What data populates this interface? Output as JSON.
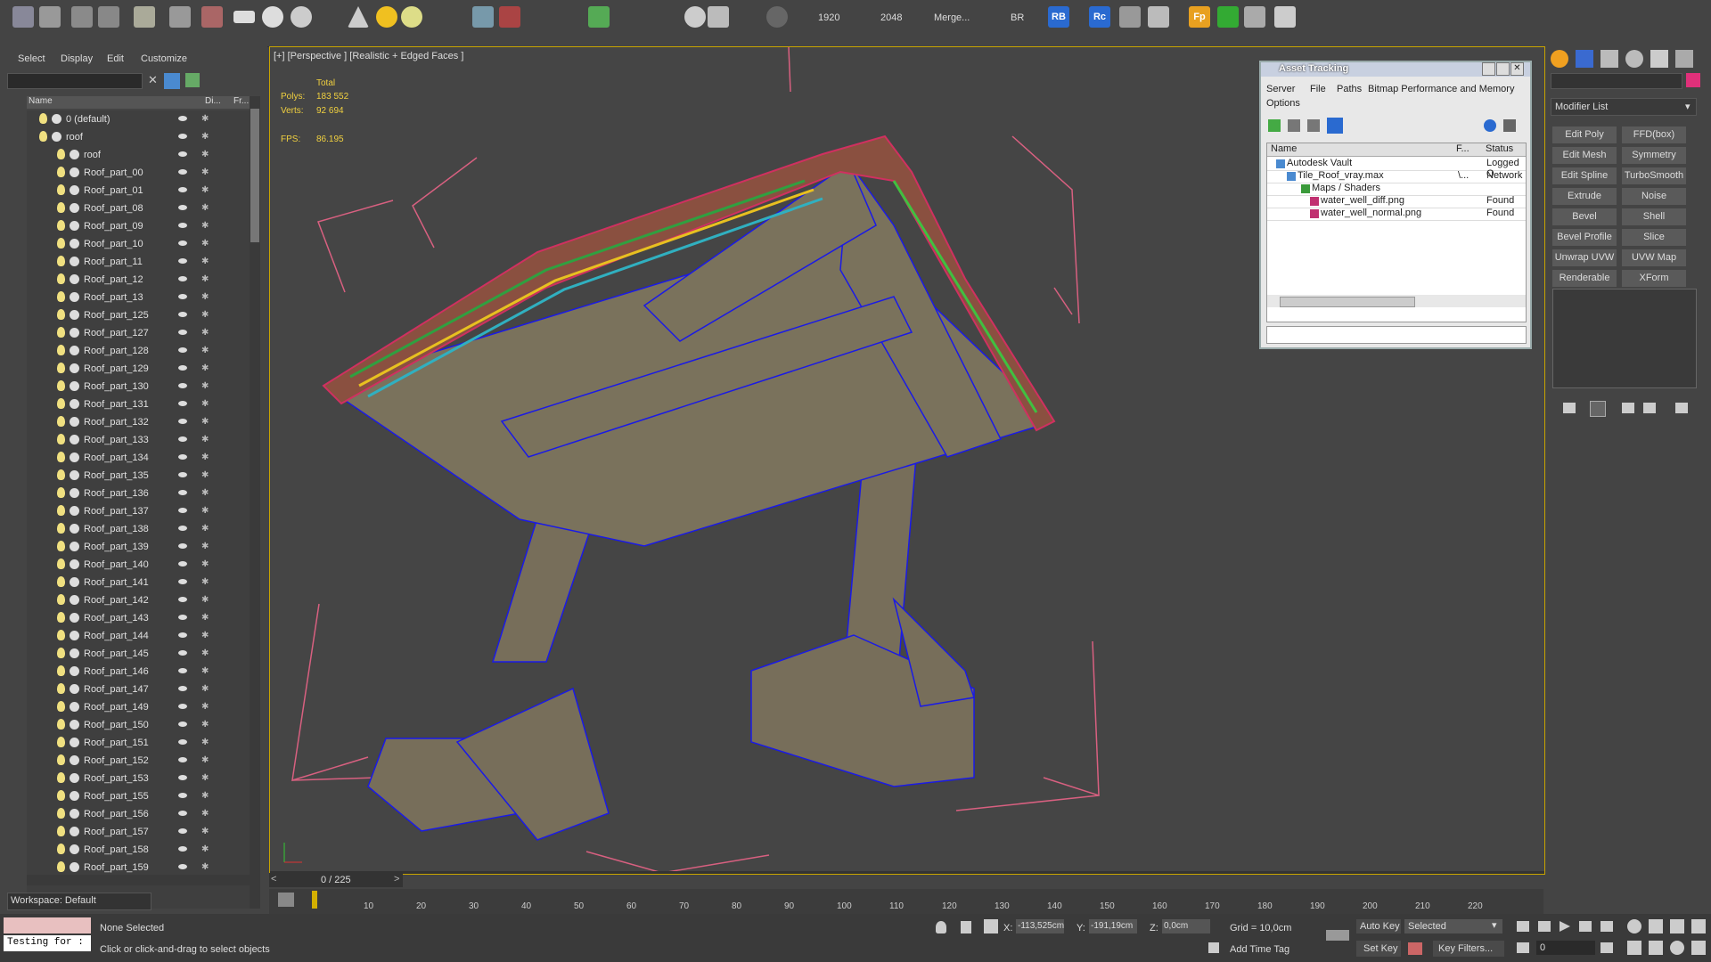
{
  "toolbar": {
    "text_items": [
      "1920",
      "2048",
      "Merge...",
      "BR"
    ],
    "rb_label": "RB",
    "rc_label": "Rc",
    "fp_label": "Fp",
    "icons": [
      "render-setup-icon",
      "render-frame-icon",
      "material-editor-icon",
      "scene-explorer-icon",
      "light-icon",
      "layer-manager-icon",
      "snap-icon",
      "plane-icon",
      "sphere-icon",
      "cylinder-icon",
      "cone-icon",
      "sun-icon",
      "torus-icon",
      "noise-icon",
      "scatter-icon",
      "forest-icon",
      "help-icon"
    ]
  },
  "scene_explorer": {
    "menu": [
      "Select",
      "Display",
      "Edit",
      "Customize"
    ],
    "columns": [
      "Name",
      "Di...",
      "Fr..."
    ],
    "items": [
      {
        "label": "0 (default)",
        "indent": 0
      },
      {
        "label": "roof",
        "indent": 0
      },
      {
        "label": "roof",
        "indent": 1
      },
      {
        "label": "Roof_part_00",
        "indent": 1
      },
      {
        "label": "Roof_part_01",
        "indent": 1
      },
      {
        "label": "Roof_part_08",
        "indent": 1
      },
      {
        "label": "Roof_part_09",
        "indent": 1
      },
      {
        "label": "Roof_part_10",
        "indent": 1
      },
      {
        "label": "Roof_part_11",
        "indent": 1
      },
      {
        "label": "Roof_part_12",
        "indent": 1
      },
      {
        "label": "Roof_part_13",
        "indent": 1
      },
      {
        "label": "Roof_part_125",
        "indent": 1
      },
      {
        "label": "Roof_part_127",
        "indent": 1
      },
      {
        "label": "Roof_part_128",
        "indent": 1
      },
      {
        "label": "Roof_part_129",
        "indent": 1
      },
      {
        "label": "Roof_part_130",
        "indent": 1
      },
      {
        "label": "Roof_part_131",
        "indent": 1
      },
      {
        "label": "Roof_part_132",
        "indent": 1
      },
      {
        "label": "Roof_part_133",
        "indent": 1
      },
      {
        "label": "Roof_part_134",
        "indent": 1
      },
      {
        "label": "Roof_part_135",
        "indent": 1
      },
      {
        "label": "Roof_part_136",
        "indent": 1
      },
      {
        "label": "Roof_part_137",
        "indent": 1
      },
      {
        "label": "Roof_part_138",
        "indent": 1
      },
      {
        "label": "Roof_part_139",
        "indent": 1
      },
      {
        "label": "Roof_part_140",
        "indent": 1
      },
      {
        "label": "Roof_part_141",
        "indent": 1
      },
      {
        "label": "Roof_part_142",
        "indent": 1
      },
      {
        "label": "Roof_part_143",
        "indent": 1
      },
      {
        "label": "Roof_part_144",
        "indent": 1
      },
      {
        "label": "Roof_part_145",
        "indent": 1
      },
      {
        "label": "Roof_part_146",
        "indent": 1
      },
      {
        "label": "Roof_part_147",
        "indent": 1
      },
      {
        "label": "Roof_part_149",
        "indent": 1
      },
      {
        "label": "Roof_part_150",
        "indent": 1
      },
      {
        "label": "Roof_part_151",
        "indent": 1
      },
      {
        "label": "Roof_part_152",
        "indent": 1
      },
      {
        "label": "Roof_part_153",
        "indent": 1
      },
      {
        "label": "Roof_part_155",
        "indent": 1
      },
      {
        "label": "Roof_part_156",
        "indent": 1
      },
      {
        "label": "Roof_part_157",
        "indent": 1
      },
      {
        "label": "Roof_part_158",
        "indent": 1
      },
      {
        "label": "Roof_part_159",
        "indent": 1
      }
    ],
    "workspace": "Workspace: Default"
  },
  "viewport": {
    "label": "[+] [Perspective ] [Realistic + Edged Faces ]",
    "stats": {
      "total": "Total",
      "polys_label": "Polys:",
      "polys": "183 552",
      "verts_label": "Verts:",
      "verts": "92 694",
      "fps_label": "FPS:",
      "fps": "86.195"
    },
    "frame_counter": "0 / 225"
  },
  "timeline": {
    "ticks": [
      "10",
      "20",
      "30",
      "40",
      "50",
      "60",
      "70",
      "80",
      "90",
      "100",
      "110",
      "120",
      "130",
      "140",
      "150",
      "160",
      "170",
      "180",
      "190",
      "200",
      "210",
      "220"
    ]
  },
  "asset_tracking": {
    "title": "Asset Tracking",
    "menu": [
      "Server",
      "File",
      "Paths",
      "Bitmap Performance and Memory",
      "Options"
    ],
    "columns": [
      "Name",
      "F...",
      "Status"
    ],
    "rows": [
      {
        "name": "Autodesk Vault",
        "f": "",
        "status": "Logged O"
      },
      {
        "name": "Tile_Roof_vray.max",
        "f": "\\...",
        "status": "Network"
      },
      {
        "name": "Maps / Shaders",
        "f": "",
        "status": ""
      },
      {
        "name": "water_well_diff.png",
        "f": "",
        "status": "Found"
      },
      {
        "name": "water_well_normal.png",
        "f": "",
        "status": "Found"
      }
    ]
  },
  "command_panel": {
    "modifier_list": "Modifier List",
    "buttons": [
      "Edit Poly",
      "FFD(box)",
      "Edit Mesh",
      "Symmetry",
      "Edit Spline",
      "TurboSmooth",
      "Extrude",
      "Noise",
      "Bevel",
      "Shell",
      "Bevel Profile",
      "Slice",
      "Unwrap UVW",
      "UVW Map",
      "Renderable Spline",
      "XForm"
    ]
  },
  "status": {
    "maxscript": "Testing for :",
    "selection": "None Selected",
    "prompt": "Click or click-and-drag to select objects",
    "x_label": "X:",
    "x": "-113,525cm",
    "y_label": "Y:",
    "y": "-191,19cm",
    "z_label": "Z:",
    "z": "0,0cm",
    "grid": "Grid = 10,0cm",
    "add_time_tag": "Add Time Tag",
    "auto_key": "Auto Key",
    "selected": "Selected",
    "set_key": "Set Key",
    "key_filters": "Key Filters...",
    "frame": "0"
  },
  "colors": {
    "viewport_bg": "#454545",
    "wire": "#1a1ae6",
    "stats": "#f0d040",
    "bbox": "#e06080"
  }
}
